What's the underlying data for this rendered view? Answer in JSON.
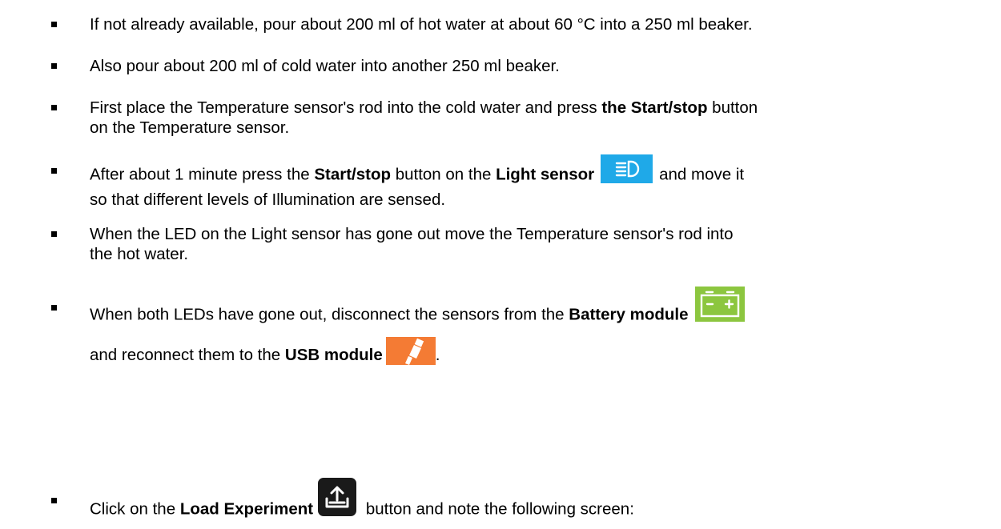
{
  "steps": [
    {
      "text": "If not already available, pour about 200 ml of hot water at about 60 °C into a 250 ml beaker."
    },
    {
      "text": "Also pour about 200 ml of cold water into another 250 ml beaker."
    },
    {
      "line1_start": "First place the Temperature sensor's rod into the cold water and press ",
      "line1_bold": "the Start/stop",
      "line1_end": " button",
      "line2": "on the Temperature sensor."
    },
    {
      "a": "After about 1 minute press the ",
      "b": "Start/stop",
      "c": " button on the ",
      "d": "Light sensor",
      "e": "and move it",
      "line2": "so that different levels of Illumination are sensed."
    },
    {
      "line1": "When the LED on the Light sensor has gone out move the Temperature sensor's rod into",
      "line2": "the hot water."
    },
    {
      "a": "When both LEDs have gone out, disconnect the sensors from the ",
      "b": "Battery module",
      "c": "and reconnect them to the ",
      "d": "USB module",
      "e": "."
    },
    {
      "a": "Click on the ",
      "b": "Load Experiment",
      "c": " button and note the following screen:"
    }
  ],
  "icons": {
    "light_sensor": "light-sensor-icon",
    "battery_module": "battery-module-icon",
    "usb_module": "usb-module-icon",
    "load_experiment": "upload-icon"
  },
  "colors": {
    "light_sensor": "#1fa9e8",
    "battery_module": "#8cc63f",
    "usb_module": "#f47b34",
    "load_experiment": "#1a1a1a"
  }
}
